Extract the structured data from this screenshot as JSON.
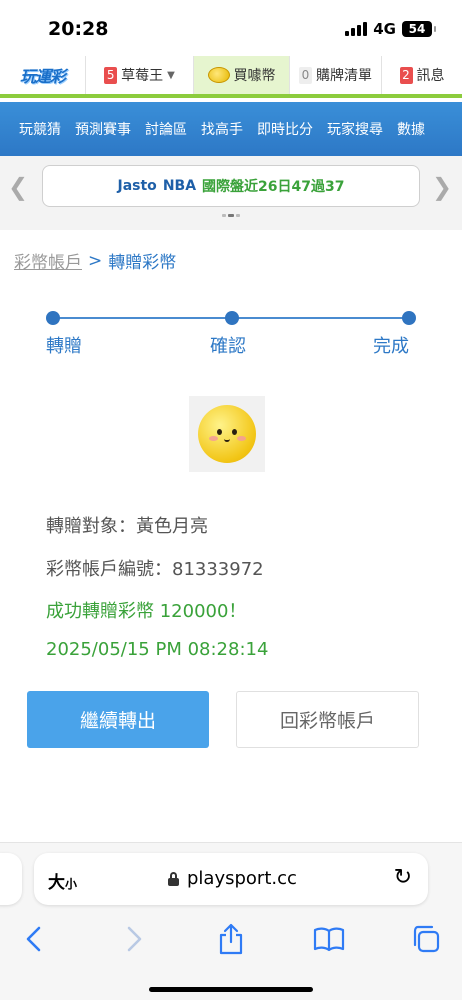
{
  "status": {
    "time": "20:28",
    "network": "4G",
    "battery": "54"
  },
  "site_nav": {
    "logo": "玩運彩",
    "items": [
      {
        "badge": "5",
        "label": "草莓王"
      },
      {
        "label": "買噱幣"
      },
      {
        "badge": "0",
        "label": "購牌清單"
      },
      {
        "badge": "2",
        "label": "訊息"
      }
    ]
  },
  "menu": [
    "玩競猜",
    "預測賽事",
    "討論區",
    "找高手",
    "即時比分",
    "玩家搜尋",
    "數據"
  ],
  "ticker": {
    "name": "Jasto",
    "league": "NBA",
    "text": "國際盤近26日47過37"
  },
  "breadcrumb": {
    "parent": "彩幣帳戶",
    "separator": ">",
    "current": "轉贈彩幣"
  },
  "steps": [
    "轉贈",
    "確認",
    "完成"
  ],
  "result": {
    "recipient": "轉贈對象：黃色月亮",
    "account": "彩幣帳戶編號：81333972",
    "success": "成功轉贈彩幣 120000！",
    "timestamp": "2025/05/15 PM 08:28:14"
  },
  "buttons": {
    "continue": "繼續轉出",
    "back": "回彩幣帳戶"
  },
  "browser": {
    "text_size_big": "大",
    "text_size_small": "小",
    "url": "playsport.cc"
  },
  "colors": {
    "primary_blue": "#2d78c6",
    "button_blue": "#4aa3ea",
    "success_green": "#3aa23a",
    "nav_green": "#8ccc3d"
  }
}
